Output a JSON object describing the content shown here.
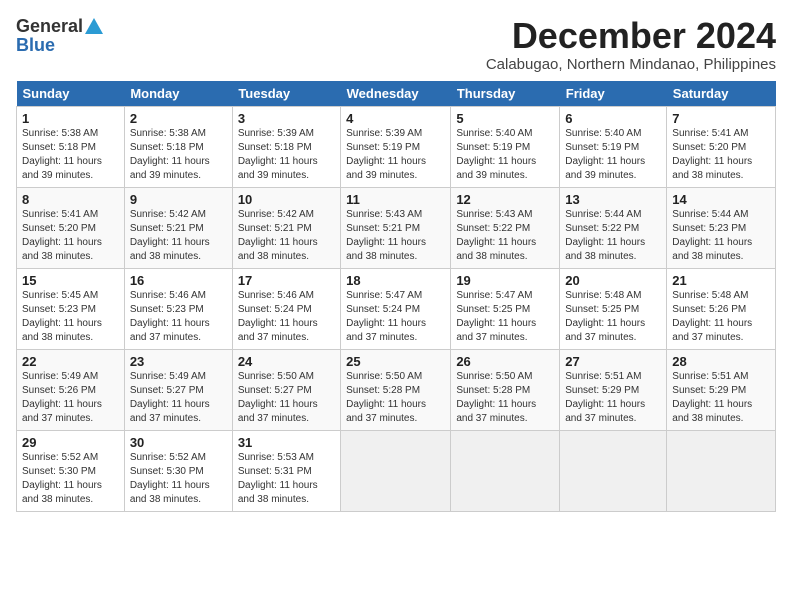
{
  "header": {
    "logo_general": "General",
    "logo_blue": "Blue",
    "month_title": "December 2024",
    "location": "Calabugao, Northern Mindanao, Philippines"
  },
  "days_of_week": [
    "Sunday",
    "Monday",
    "Tuesday",
    "Wednesday",
    "Thursday",
    "Friday",
    "Saturday"
  ],
  "weeks": [
    [
      {
        "day": "1",
        "sunrise": "5:38 AM",
        "sunset": "5:18 PM",
        "daylight": "11 hours and 39 minutes."
      },
      {
        "day": "2",
        "sunrise": "5:38 AM",
        "sunset": "5:18 PM",
        "daylight": "11 hours and 39 minutes."
      },
      {
        "day": "3",
        "sunrise": "5:39 AM",
        "sunset": "5:18 PM",
        "daylight": "11 hours and 39 minutes."
      },
      {
        "day": "4",
        "sunrise": "5:39 AM",
        "sunset": "5:19 PM",
        "daylight": "11 hours and 39 minutes."
      },
      {
        "day": "5",
        "sunrise": "5:40 AM",
        "sunset": "5:19 PM",
        "daylight": "11 hours and 39 minutes."
      },
      {
        "day": "6",
        "sunrise": "5:40 AM",
        "sunset": "5:19 PM",
        "daylight": "11 hours and 39 minutes."
      },
      {
        "day": "7",
        "sunrise": "5:41 AM",
        "sunset": "5:20 PM",
        "daylight": "11 hours and 38 minutes."
      }
    ],
    [
      {
        "day": "8",
        "sunrise": "5:41 AM",
        "sunset": "5:20 PM",
        "daylight": "11 hours and 38 minutes."
      },
      {
        "day": "9",
        "sunrise": "5:42 AM",
        "sunset": "5:21 PM",
        "daylight": "11 hours and 38 minutes."
      },
      {
        "day": "10",
        "sunrise": "5:42 AM",
        "sunset": "5:21 PM",
        "daylight": "11 hours and 38 minutes."
      },
      {
        "day": "11",
        "sunrise": "5:43 AM",
        "sunset": "5:21 PM",
        "daylight": "11 hours and 38 minutes."
      },
      {
        "day": "12",
        "sunrise": "5:43 AM",
        "sunset": "5:22 PM",
        "daylight": "11 hours and 38 minutes."
      },
      {
        "day": "13",
        "sunrise": "5:44 AM",
        "sunset": "5:22 PM",
        "daylight": "11 hours and 38 minutes."
      },
      {
        "day": "14",
        "sunrise": "5:44 AM",
        "sunset": "5:23 PM",
        "daylight": "11 hours and 38 minutes."
      }
    ],
    [
      {
        "day": "15",
        "sunrise": "5:45 AM",
        "sunset": "5:23 PM",
        "daylight": "11 hours and 38 minutes."
      },
      {
        "day": "16",
        "sunrise": "5:46 AM",
        "sunset": "5:23 PM",
        "daylight": "11 hours and 37 minutes."
      },
      {
        "day": "17",
        "sunrise": "5:46 AM",
        "sunset": "5:24 PM",
        "daylight": "11 hours and 37 minutes."
      },
      {
        "day": "18",
        "sunrise": "5:47 AM",
        "sunset": "5:24 PM",
        "daylight": "11 hours and 37 minutes."
      },
      {
        "day": "19",
        "sunrise": "5:47 AM",
        "sunset": "5:25 PM",
        "daylight": "11 hours and 37 minutes."
      },
      {
        "day": "20",
        "sunrise": "5:48 AM",
        "sunset": "5:25 PM",
        "daylight": "11 hours and 37 minutes."
      },
      {
        "day": "21",
        "sunrise": "5:48 AM",
        "sunset": "5:26 PM",
        "daylight": "11 hours and 37 minutes."
      }
    ],
    [
      {
        "day": "22",
        "sunrise": "5:49 AM",
        "sunset": "5:26 PM",
        "daylight": "11 hours and 37 minutes."
      },
      {
        "day": "23",
        "sunrise": "5:49 AM",
        "sunset": "5:27 PM",
        "daylight": "11 hours and 37 minutes."
      },
      {
        "day": "24",
        "sunrise": "5:50 AM",
        "sunset": "5:27 PM",
        "daylight": "11 hours and 37 minutes."
      },
      {
        "day": "25",
        "sunrise": "5:50 AM",
        "sunset": "5:28 PM",
        "daylight": "11 hours and 37 minutes."
      },
      {
        "day": "26",
        "sunrise": "5:50 AM",
        "sunset": "5:28 PM",
        "daylight": "11 hours and 37 minutes."
      },
      {
        "day": "27",
        "sunrise": "5:51 AM",
        "sunset": "5:29 PM",
        "daylight": "11 hours and 37 minutes."
      },
      {
        "day": "28",
        "sunrise": "5:51 AM",
        "sunset": "5:29 PM",
        "daylight": "11 hours and 38 minutes."
      }
    ],
    [
      {
        "day": "29",
        "sunrise": "5:52 AM",
        "sunset": "5:30 PM",
        "daylight": "11 hours and 38 minutes."
      },
      {
        "day": "30",
        "sunrise": "5:52 AM",
        "sunset": "5:30 PM",
        "daylight": "11 hours and 38 minutes."
      },
      {
        "day": "31",
        "sunrise": "5:53 AM",
        "sunset": "5:31 PM",
        "daylight": "11 hours and 38 minutes."
      },
      null,
      null,
      null,
      null
    ]
  ]
}
